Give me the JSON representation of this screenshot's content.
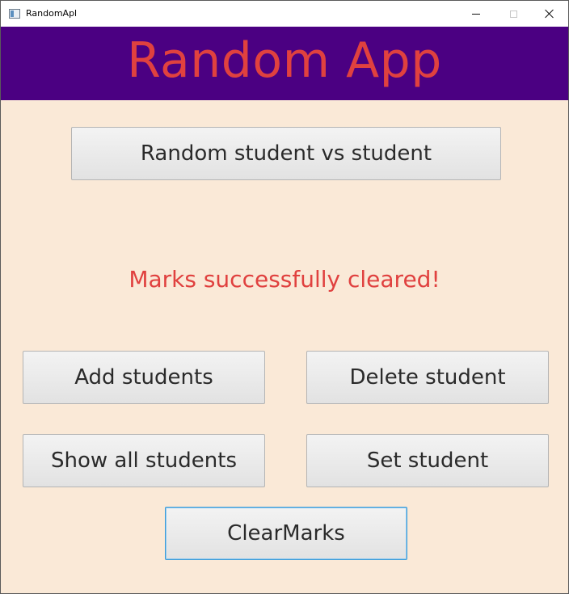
{
  "window": {
    "title": "RandomApl"
  },
  "header": {
    "title": "Random App",
    "background": "#4b0082",
    "title_color": "#e0413f"
  },
  "main": {
    "random_button_label": "Random student vs student",
    "status_message": "Marks successfully cleared!",
    "status_color": "#e0413f",
    "background": "#fae9d7",
    "buttons": {
      "add_students": "Add students",
      "delete_student": "Delete student",
      "show_all_students": "Show all students",
      "set_student": "Set student",
      "clear_marks": "ClearMarks"
    }
  },
  "icons": {
    "app": "app-window-icon",
    "minimize": "minimize-icon",
    "maximize": "maximize-icon",
    "close": "close-icon"
  }
}
